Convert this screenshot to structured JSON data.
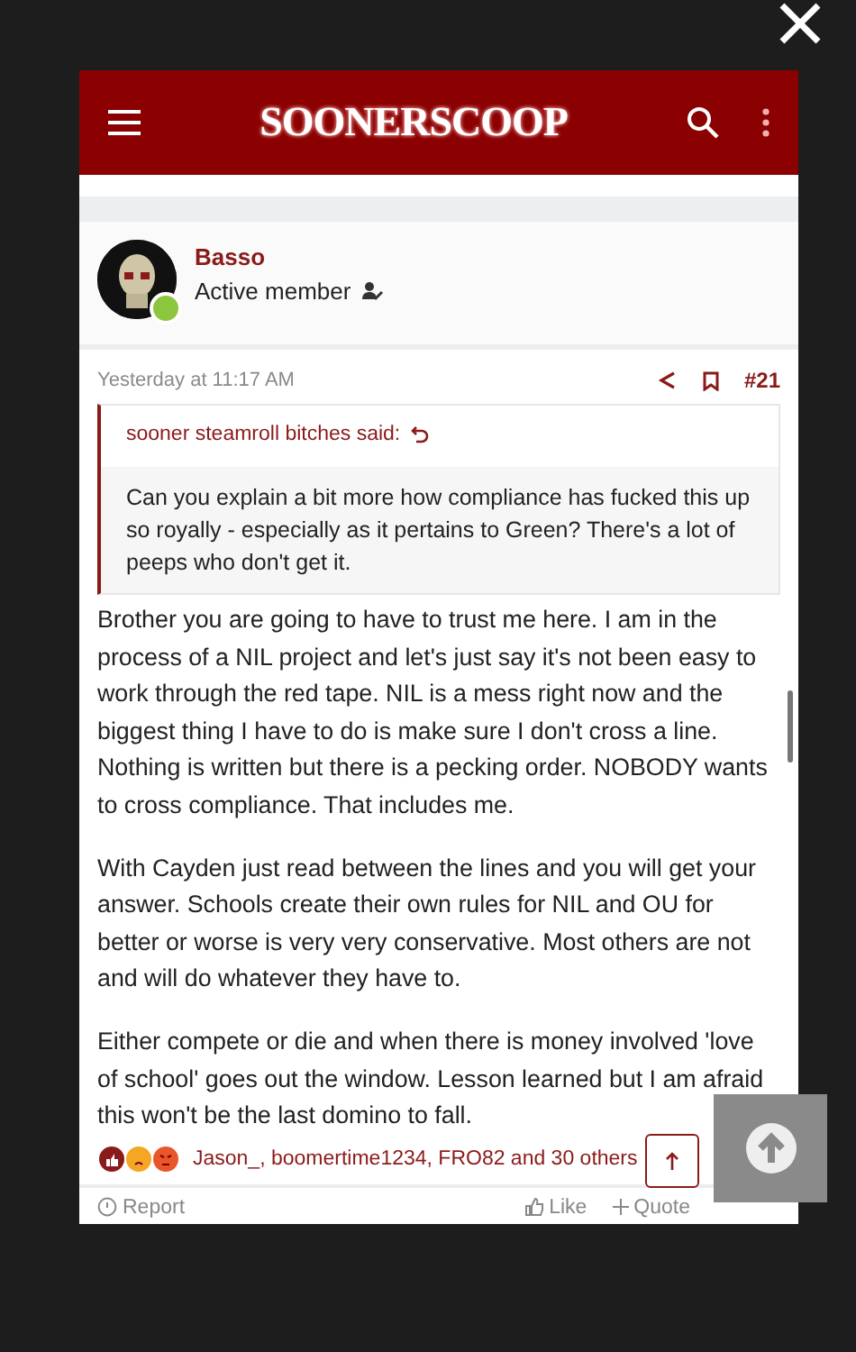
{
  "header": {
    "logo": "SOONERSCOOP"
  },
  "post": {
    "author": "Basso",
    "role": "Active member",
    "online": true,
    "time": "Yesterday at 11:17 AM",
    "number": "#21",
    "quote": {
      "author": "sooner steamroll bitches said:",
      "text": "Can you explain a bit more how compliance has fucked this up so royally - especially as it pertains to Green? There's a lot of peeps who don't get it."
    },
    "paragraphs": [
      "Brother you are going to have to trust me here. I am in the process of a NIL project and let's just say it's not been easy to work through the red tape. NIL is a mess right now and the biggest thing I have to do is make sure I don't cross a line. Nothing is written but there is a pecking order. NOBODY wants to cross compliance. That includes me.",
      "With Cayden just read between the lines and you will get your answer. Schools create their own rules for NIL and OU for better or worse is very very conservative. Most others are not and will do whatever they have to.",
      "Either compete or die and when there is money involved 'love of school' goes out the window. Lesson learned but I am afraid this won't be the last domino to fall."
    ],
    "reactions": {
      "names": "Jason_, boomertime1234, FRO82 and 30 others",
      "icons": [
        {
          "kind": "like",
          "color": "#8b1a1a"
        },
        {
          "kind": "sad",
          "color": "#f5a623"
        },
        {
          "kind": "angry",
          "color": "#e8562a"
        }
      ]
    },
    "actions": [
      {
        "kind": "report",
        "label": "Report"
      },
      {
        "kind": "like",
        "label": "Like"
      },
      {
        "kind": "quote",
        "label": "Quote"
      }
    ]
  }
}
